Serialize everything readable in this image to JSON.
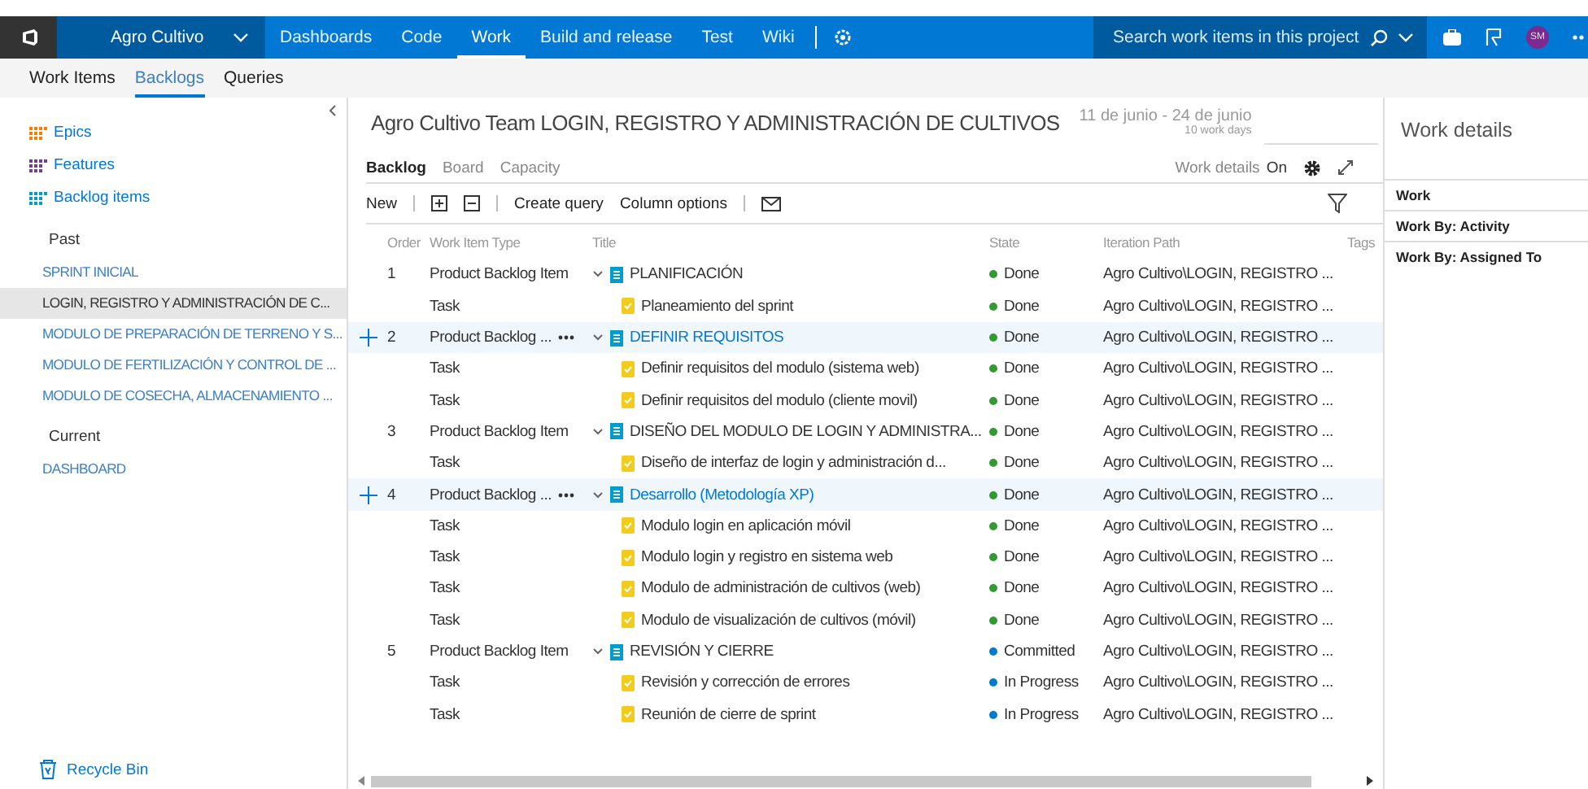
{
  "nav": {
    "project": "Agro Cultivo",
    "items": [
      {
        "label": "Dashboards",
        "selected": false
      },
      {
        "label": "Code",
        "selected": false
      },
      {
        "label": "Work",
        "selected": true
      },
      {
        "label": "Build and release",
        "selected": false
      },
      {
        "label": "Test",
        "selected": false
      },
      {
        "label": "Wiki",
        "selected": false
      }
    ],
    "search": {
      "placeholder": "Search work items in this project"
    },
    "avatar": "SM"
  },
  "subnav": [
    {
      "label": "Work Items",
      "selected": false
    },
    {
      "label": "Backlogs",
      "selected": true
    },
    {
      "label": "Queries",
      "selected": false
    }
  ],
  "sidebar": {
    "levels": [
      {
        "label": "Epics",
        "color": "#ff7b00"
      },
      {
        "label": "Features",
        "color": "#773b93"
      },
      {
        "label": "Backlog items",
        "color": "#009ccc"
      }
    ],
    "groups": [
      {
        "label": "Past",
        "items": [
          {
            "label": "SPRINT INICIAL",
            "selected": false
          },
          {
            "label": "LOGIN, REGISTRO Y ADMINISTRACIÓN DE C...",
            "selected": true
          },
          {
            "label": "MODULO DE PREPARACIÓN DE TERRENO Y S...",
            "selected": false
          },
          {
            "label": "MODULO DE FERTILIZACIÓN Y CONTROL DE ...",
            "selected": false
          },
          {
            "label": "MODULO DE COSECHA, ALMACENAMIENTO ...",
            "selected": false
          }
        ]
      },
      {
        "label": "Current",
        "items": [
          {
            "label": "DASHBOARD",
            "selected": false
          }
        ]
      }
    ],
    "recycle_bin": "Recycle Bin"
  },
  "header": {
    "title": "Agro Cultivo Team LOGIN, REGISTRO Y ADMINISTRACIÓN DE CULTIVOS",
    "date_range": "11 de junio - 24 de junio",
    "work_days": "10 work days",
    "tabs": [
      {
        "label": "Backlog",
        "selected": true
      },
      {
        "label": "Board",
        "selected": false
      },
      {
        "label": "Capacity",
        "selected": false
      }
    ],
    "work_details": {
      "label": "Work details",
      "state": "On"
    }
  },
  "toolbar": {
    "new": "New",
    "create_query": "Create query",
    "column_options": "Column options"
  },
  "table": {
    "columns": [
      "Order",
      "Work Item Type",
      "Title",
      "State",
      "Iteration Path",
      "Tags"
    ],
    "rows": [
      {
        "kind": "parent",
        "order": "1",
        "type": "Product Backlog Item",
        "title": "PLANIFICACIÓN",
        "state": "Done",
        "color": "#339933",
        "iteration": "Agro Cultivo\\LOGIN, REGISTRO ...",
        "selected": false
      },
      {
        "kind": "task",
        "type": "Task",
        "title": "Planeamiento del sprint",
        "state": "Done",
        "color": "#339933",
        "iteration": "Agro Cultivo\\LOGIN, REGISTRO ...",
        "selected": false
      },
      {
        "kind": "parent",
        "order": "2",
        "type": "Product Backlog ...",
        "title": "DEFINIR REQUISITOS",
        "state": "Done",
        "color": "#339933",
        "iteration": "Agro Cultivo\\LOGIN, REGISTRO ...",
        "selected": true
      },
      {
        "kind": "task",
        "type": "Task",
        "title": "Definir requisitos del modulo (sistema web)",
        "state": "Done",
        "color": "#339933",
        "iteration": "Agro Cultivo\\LOGIN, REGISTRO ...",
        "selected": false
      },
      {
        "kind": "task",
        "type": "Task",
        "title": "Definir requisitos del modulo (cliente movil)",
        "state": "Done",
        "color": "#339933",
        "iteration": "Agro Cultivo\\LOGIN, REGISTRO ...",
        "selected": false
      },
      {
        "kind": "parent",
        "order": "3",
        "type": "Product Backlog Item",
        "title": "DISEÑO DEL MODULO DE LOGIN Y ADMINISTRA...",
        "state": "Done",
        "color": "#339933",
        "iteration": "Agro Cultivo\\LOGIN, REGISTRO ...",
        "selected": false
      },
      {
        "kind": "task",
        "type": "Task",
        "title": "Diseño de interfaz de login y administración d...",
        "state": "Done",
        "color": "#339933",
        "iteration": "Agro Cultivo\\LOGIN, REGISTRO ...",
        "selected": false
      },
      {
        "kind": "parent",
        "order": "4",
        "type": "Product Backlog ...",
        "title": "Desarrollo (Metodología XP)",
        "state": "Done",
        "color": "#339933",
        "iteration": "Agro Cultivo\\LOGIN, REGISTRO ...",
        "selected": true
      },
      {
        "kind": "task",
        "type": "Task",
        "title": "Modulo login en aplicación móvil",
        "state": "Done",
        "color": "#339933",
        "iteration": "Agro Cultivo\\LOGIN, REGISTRO ...",
        "selected": false
      },
      {
        "kind": "task",
        "type": "Task",
        "title": "Modulo login y registro en sistema web",
        "state": "Done",
        "color": "#339933",
        "iteration": "Agro Cultivo\\LOGIN, REGISTRO ...",
        "selected": false
      },
      {
        "kind": "task",
        "type": "Task",
        "title": "Modulo de administración de cultivos (web)",
        "state": "Done",
        "color": "#339933",
        "iteration": "Agro Cultivo\\LOGIN, REGISTRO ...",
        "selected": false
      },
      {
        "kind": "task",
        "type": "Task",
        "title": "Modulo de visualización de cultivos (móvil)",
        "state": "Done",
        "color": "#339933",
        "iteration": "Agro Cultivo\\LOGIN, REGISTRO ...",
        "selected": false
      },
      {
        "kind": "parent",
        "order": "5",
        "type": "Product Backlog Item",
        "title": "REVISIÓN Y CIERRE",
        "state": "Committed",
        "color": "#007acc",
        "iteration": "Agro Cultivo\\LOGIN, REGISTRO ...",
        "selected": false
      },
      {
        "kind": "task",
        "type": "Task",
        "title": "Revisión y corrección de errores",
        "state": "In Progress",
        "color": "#007acc",
        "iteration": "Agro Cultivo\\LOGIN, REGISTRO ...",
        "selected": false
      },
      {
        "kind": "task",
        "type": "Task",
        "title": "Reunión de cierre de sprint",
        "state": "In Progress",
        "color": "#007acc",
        "iteration": "Agro Cultivo\\LOGIN, REGISTRO ...",
        "selected": false
      }
    ]
  },
  "details_panel": {
    "title": "Work details",
    "items": [
      "Work",
      "Work By: Activity",
      "Work By: Assigned To"
    ]
  }
}
